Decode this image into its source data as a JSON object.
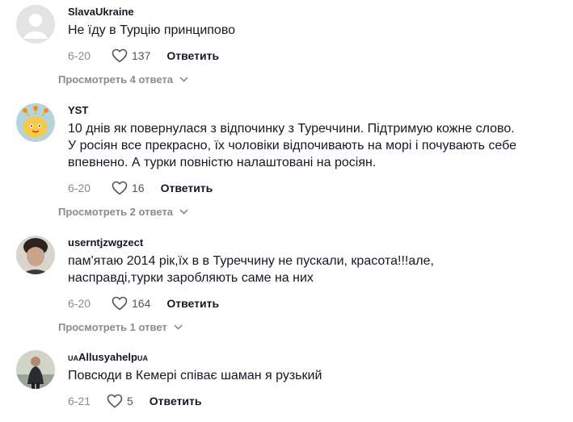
{
  "comments": [
    {
      "username": "SlavaUkraine",
      "text": "Не їду в Турцію принципово",
      "date": "6-20",
      "likes": "137",
      "reply_label": "Ответить",
      "view_replies": "Просмотреть 4 ответа"
    },
    {
      "username": "YST",
      "text": "10 днів як повернулася з відпочинку з Туреччини. Підтримую кожне слово.\nУ росіян все прекрасно, їх чоловіки відпочивають на морі і почувають себе\nвпевнено. А турки повністю налаштовані на росіян.",
      "date": "6-20",
      "likes": "16",
      "reply_label": "Ответить",
      "view_replies": "Просмотреть 2 ответа"
    },
    {
      "username": "userntjzwgzect",
      "text": "пам'ятаю 2014 рік,їх в в Туреччину не пускали, красота!!!але,\nнасправді,турки заробляють саме на них",
      "date": "6-20",
      "likes": "164",
      "reply_label": "Ответить",
      "view_replies": "Просмотреть 1 ответ"
    },
    {
      "username_prefix": "UA",
      "username": "Allusyahelp",
      "username_suffix": "UA",
      "text": "Повсюди в Кемері співає шаман я рузький",
      "date": "6-21",
      "likes": "5",
      "reply_label": "Ответить"
    }
  ],
  "colors": {
    "text_primary": "#161823",
    "text_secondary": "#8a8b91",
    "avatar_placeholder": "#e3e3e4"
  },
  "icons": {
    "like": "heart-outline-icon",
    "expand": "chevron-down-icon"
  }
}
